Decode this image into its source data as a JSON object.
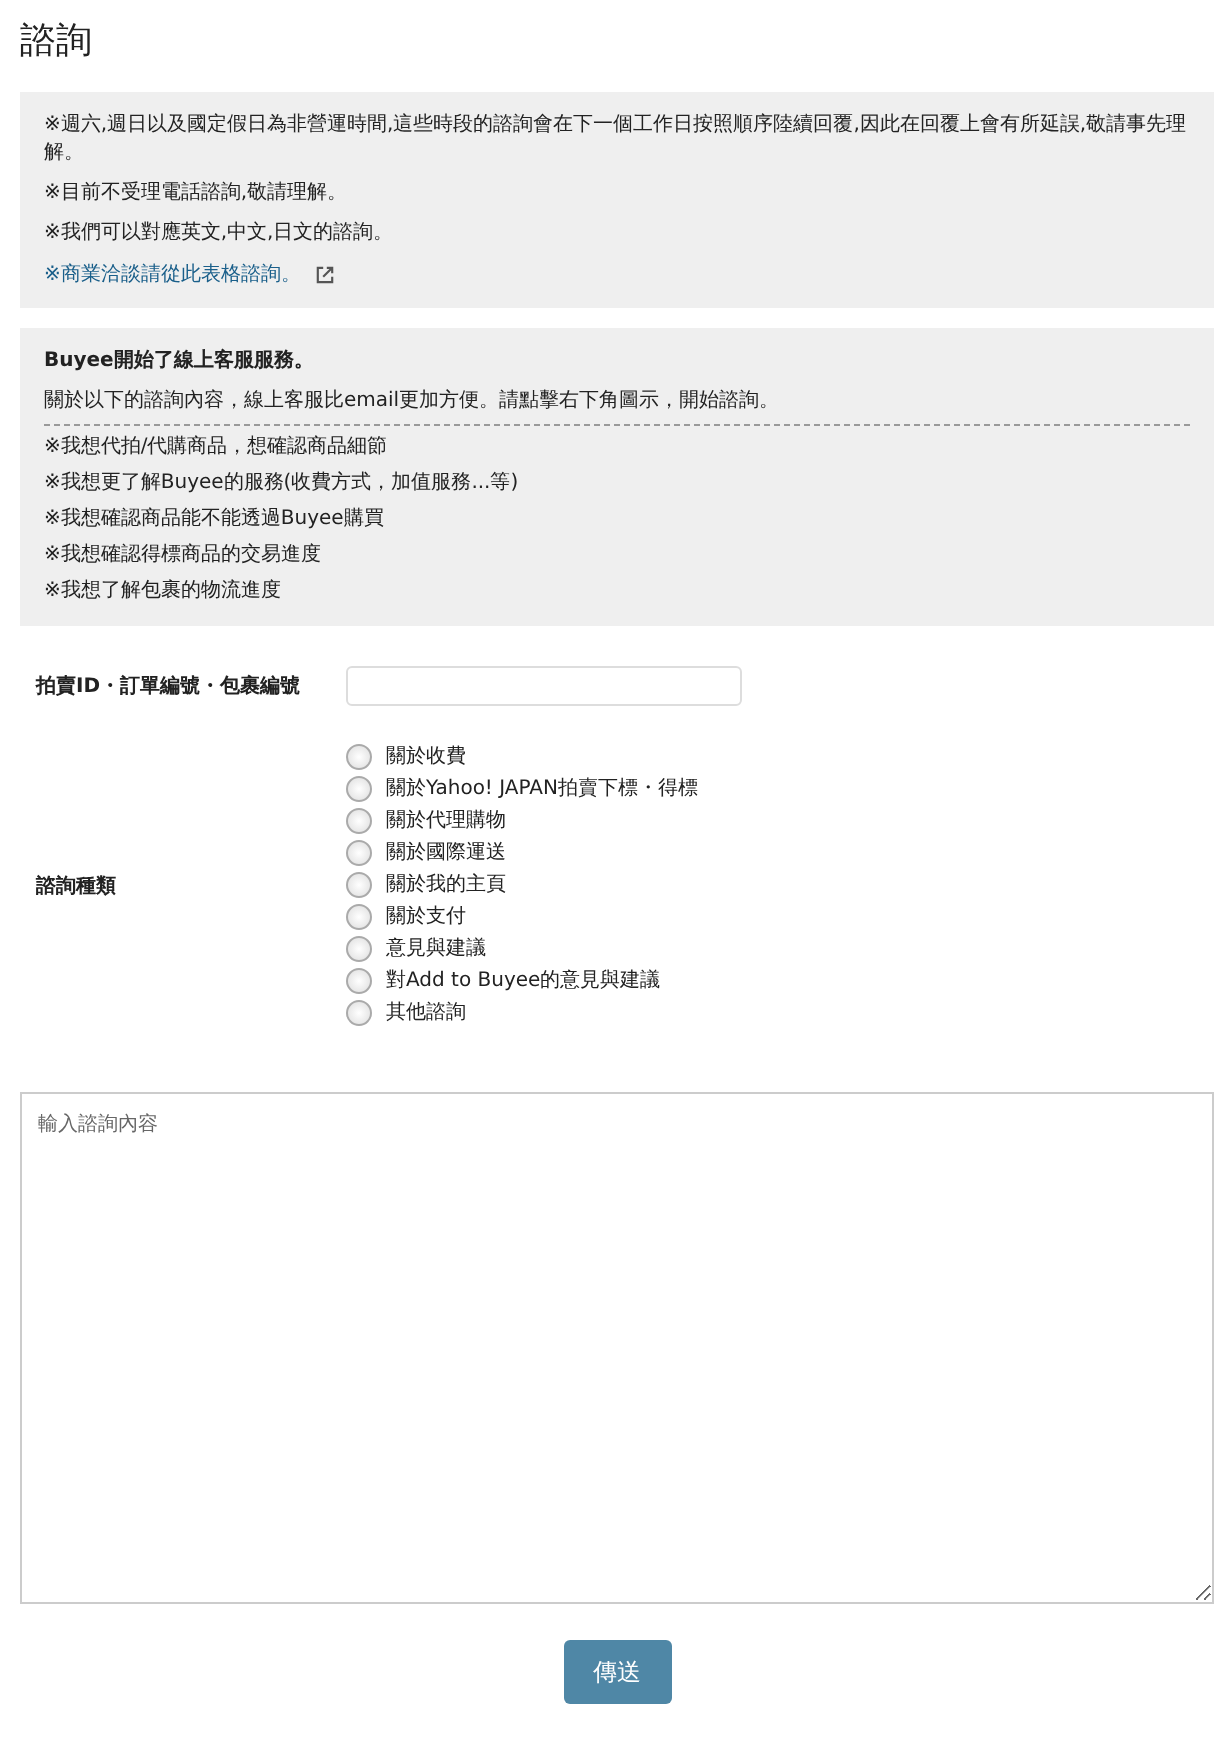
{
  "title": "諮詢",
  "notice": {
    "lines": [
      "※週六,週日以及國定假日為非營運時間,這些時段的諮詢會在下一個工作日按照順序陸續回覆,因此在回覆上會有所延誤,敬請事先理解。",
      "※目前不受理電話諮詢,敬請理解。",
      "※我們可以對應英文,中文,日文的諮詢。"
    ],
    "link": "※商業洽談請從此表格諮詢。"
  },
  "chat_notice": {
    "heading": "Buyee開始了線上客服服務。",
    "intro": "關於以下的諮詢內容，線上客服比email更加方便。請點擊右下角圖示，開始諮詢。",
    "items": [
      "※我想代拍/代購商品，想確認商品細節",
      "※我想更了解Buyee的服務(收費方式，加值服務...等)",
      "※我想確認商品能不能透過Buyee購買",
      "※我想確認得標商品的交易進度",
      "※我想了解包裹的物流進度"
    ]
  },
  "id_field": {
    "label": "拍賣ID・訂單編號・包裹編號"
  },
  "category": {
    "label": "諮詢種類",
    "options": [
      {
        "label": "關於收費",
        "selected": false
      },
      {
        "label": "關於Yahoo! JAPAN拍賣下標・得標",
        "selected": false
      },
      {
        "label": "關於代理購物",
        "selected": false
      },
      {
        "label": "關於國際運送",
        "selected": false
      },
      {
        "label": "關於我的主頁",
        "selected": false
      },
      {
        "label": "關於支付",
        "selected": false
      },
      {
        "label": "意見與建議",
        "selected": false
      },
      {
        "label": "對Add to Buyee的意見與建議",
        "selected": false
      },
      {
        "label": "其他諮詢",
        "selected": false
      }
    ]
  },
  "message": {
    "placeholder": "輸入諮詢內容"
  },
  "submit": "傳送"
}
